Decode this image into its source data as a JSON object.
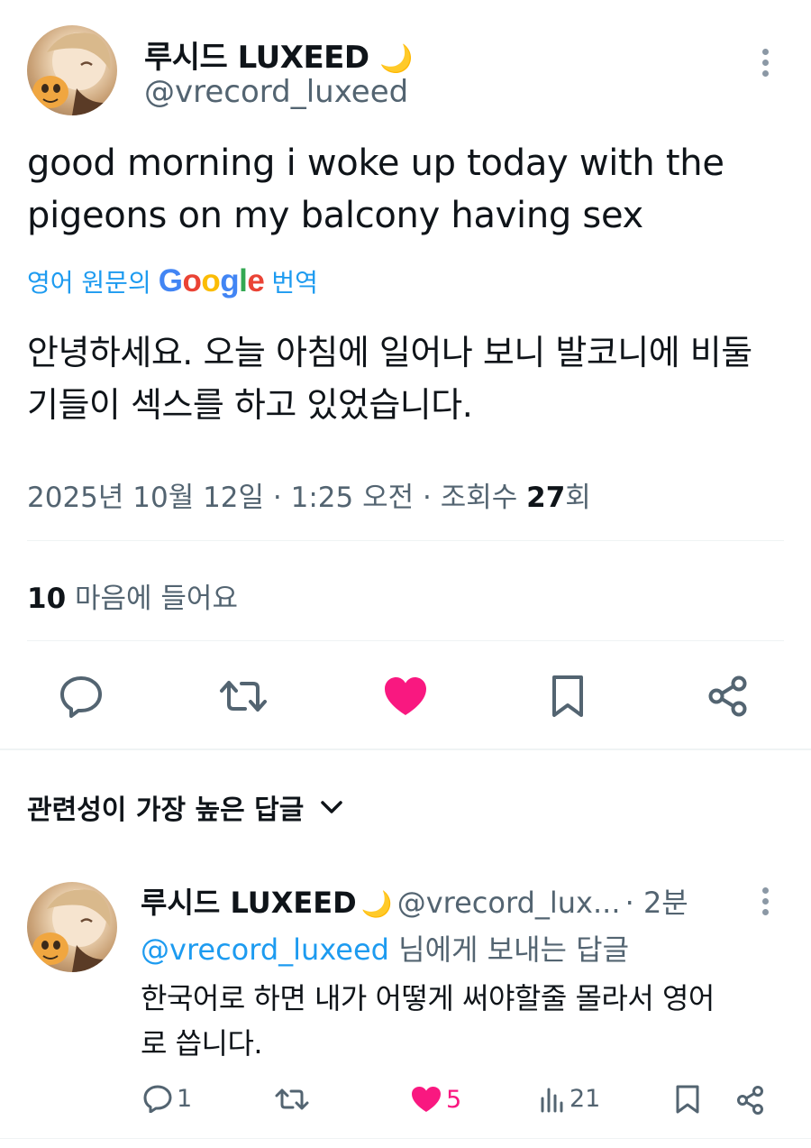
{
  "tweet": {
    "author_name": "루시드 LUXEED",
    "author_emoji": "🌙",
    "author_handle": "@vrecord_luxeed",
    "text": "good morning i woke up today with the pigeons on my balcony having sex",
    "translate": {
      "prefix": "영어 원문의",
      "brand": [
        "G",
        "o",
        "o",
        "g",
        "l",
        "e"
      ],
      "suffix": "번역"
    },
    "translated_text": "안녕하세요. 오늘 아침에 일어나 보니 발코니에 비둘기들이 섹스를 하고 있었습니다.",
    "meta": {
      "date": "2025년 10월 12일",
      "time": "1:25 오전",
      "views_label": "조회수",
      "views_count": "27",
      "views_suffix": "회"
    },
    "likes": {
      "count": "10",
      "label": "마음에 들어요"
    },
    "actions": [
      "reply-icon",
      "retweet-icon",
      "like-icon-filled",
      "bookmark-icon",
      "share-icon"
    ],
    "colors": {
      "like": "#f91880",
      "link": "#1d9bf0",
      "muted": "#536471"
    }
  },
  "replies_section": {
    "title": "관련성이 가장 높은 답글"
  },
  "reply": {
    "author_name": "루시드 LUXEED",
    "author_emoji": "🌙",
    "author_handle": "@vrecord_lux...",
    "time": "2분",
    "reply_to_mention": "@vrecord_luxeed",
    "reply_to_suffix": "님에게 보내는 답글",
    "text": "한국어로 하면 내가 어떻게 써야할줄 몰라서 영어로 씁니다.",
    "stats": {
      "replies": "1",
      "retweets": "",
      "likes": "5",
      "views": "21"
    }
  }
}
